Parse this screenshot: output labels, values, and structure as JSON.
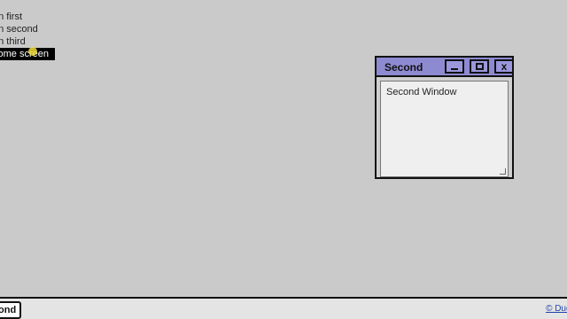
{
  "menu": {
    "items": [
      {
        "label": "en first"
      },
      {
        "label": "en second"
      },
      {
        "label": "en third"
      },
      {
        "label": "come screen"
      }
    ]
  },
  "window": {
    "title": "Second",
    "content_text": "Second Window",
    "icons": {
      "minimize": "minimize-icon",
      "maximize": "maximize-icon",
      "close": "close-icon"
    }
  },
  "taskbar": {
    "button_label": "ond",
    "credit_link": "© Duc"
  },
  "colors": {
    "desktop": "#cacaca",
    "titlebar": "#8e8ad2",
    "selected_bg": "#000000",
    "link": "#2244aa"
  }
}
